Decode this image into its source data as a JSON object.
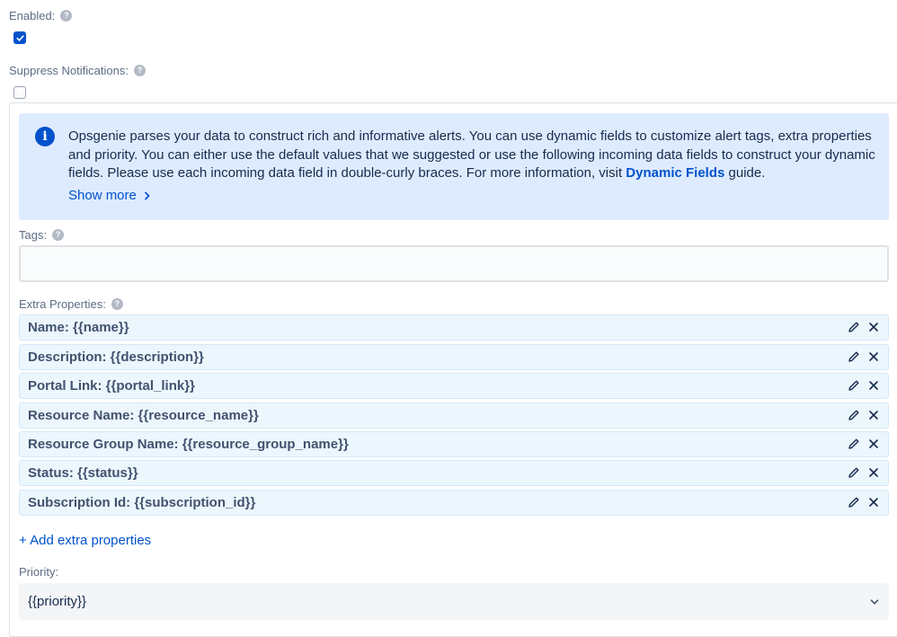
{
  "enabled": {
    "label": "Enabled:",
    "checked": true
  },
  "suppress": {
    "label": "Suppress Notifications:",
    "checked": false
  },
  "info": {
    "text_before": "Opsgenie parses your data to construct rich and informative alerts. You can use dynamic fields to customize alert tags, extra properties and priority. You can either use the default values that we suggested or use the following incoming data fields to construct your dynamic fields. Please use each incoming data field in double-curly braces. For more information, visit ",
    "link": "Dynamic Fields",
    "text_after": " guide.",
    "show_more": "Show more"
  },
  "tags": {
    "label": "Tags:",
    "value": ""
  },
  "extra_properties": {
    "label": "Extra Properties:",
    "items": [
      "Name: {{name}}",
      "Description: {{description}}",
      "Portal Link: {{portal_link}}",
      "Resource Name: {{resource_name}}",
      "Resource Group Name: {{resource_group_name}}",
      "Status: {{status}}",
      "Subscription Id: {{subscription_id}}"
    ],
    "add_label": "+ Add extra properties"
  },
  "priority": {
    "label": "Priority:",
    "value": "{{priority}}"
  },
  "colors": {
    "accent": "#0052cc",
    "info_bg": "#deebff",
    "row_bg": "#ebf6fd"
  },
  "icons": [
    "help-icon",
    "check-icon",
    "info-icon",
    "chevron-right-icon",
    "pencil-icon",
    "close-icon",
    "chevron-down-icon"
  ]
}
